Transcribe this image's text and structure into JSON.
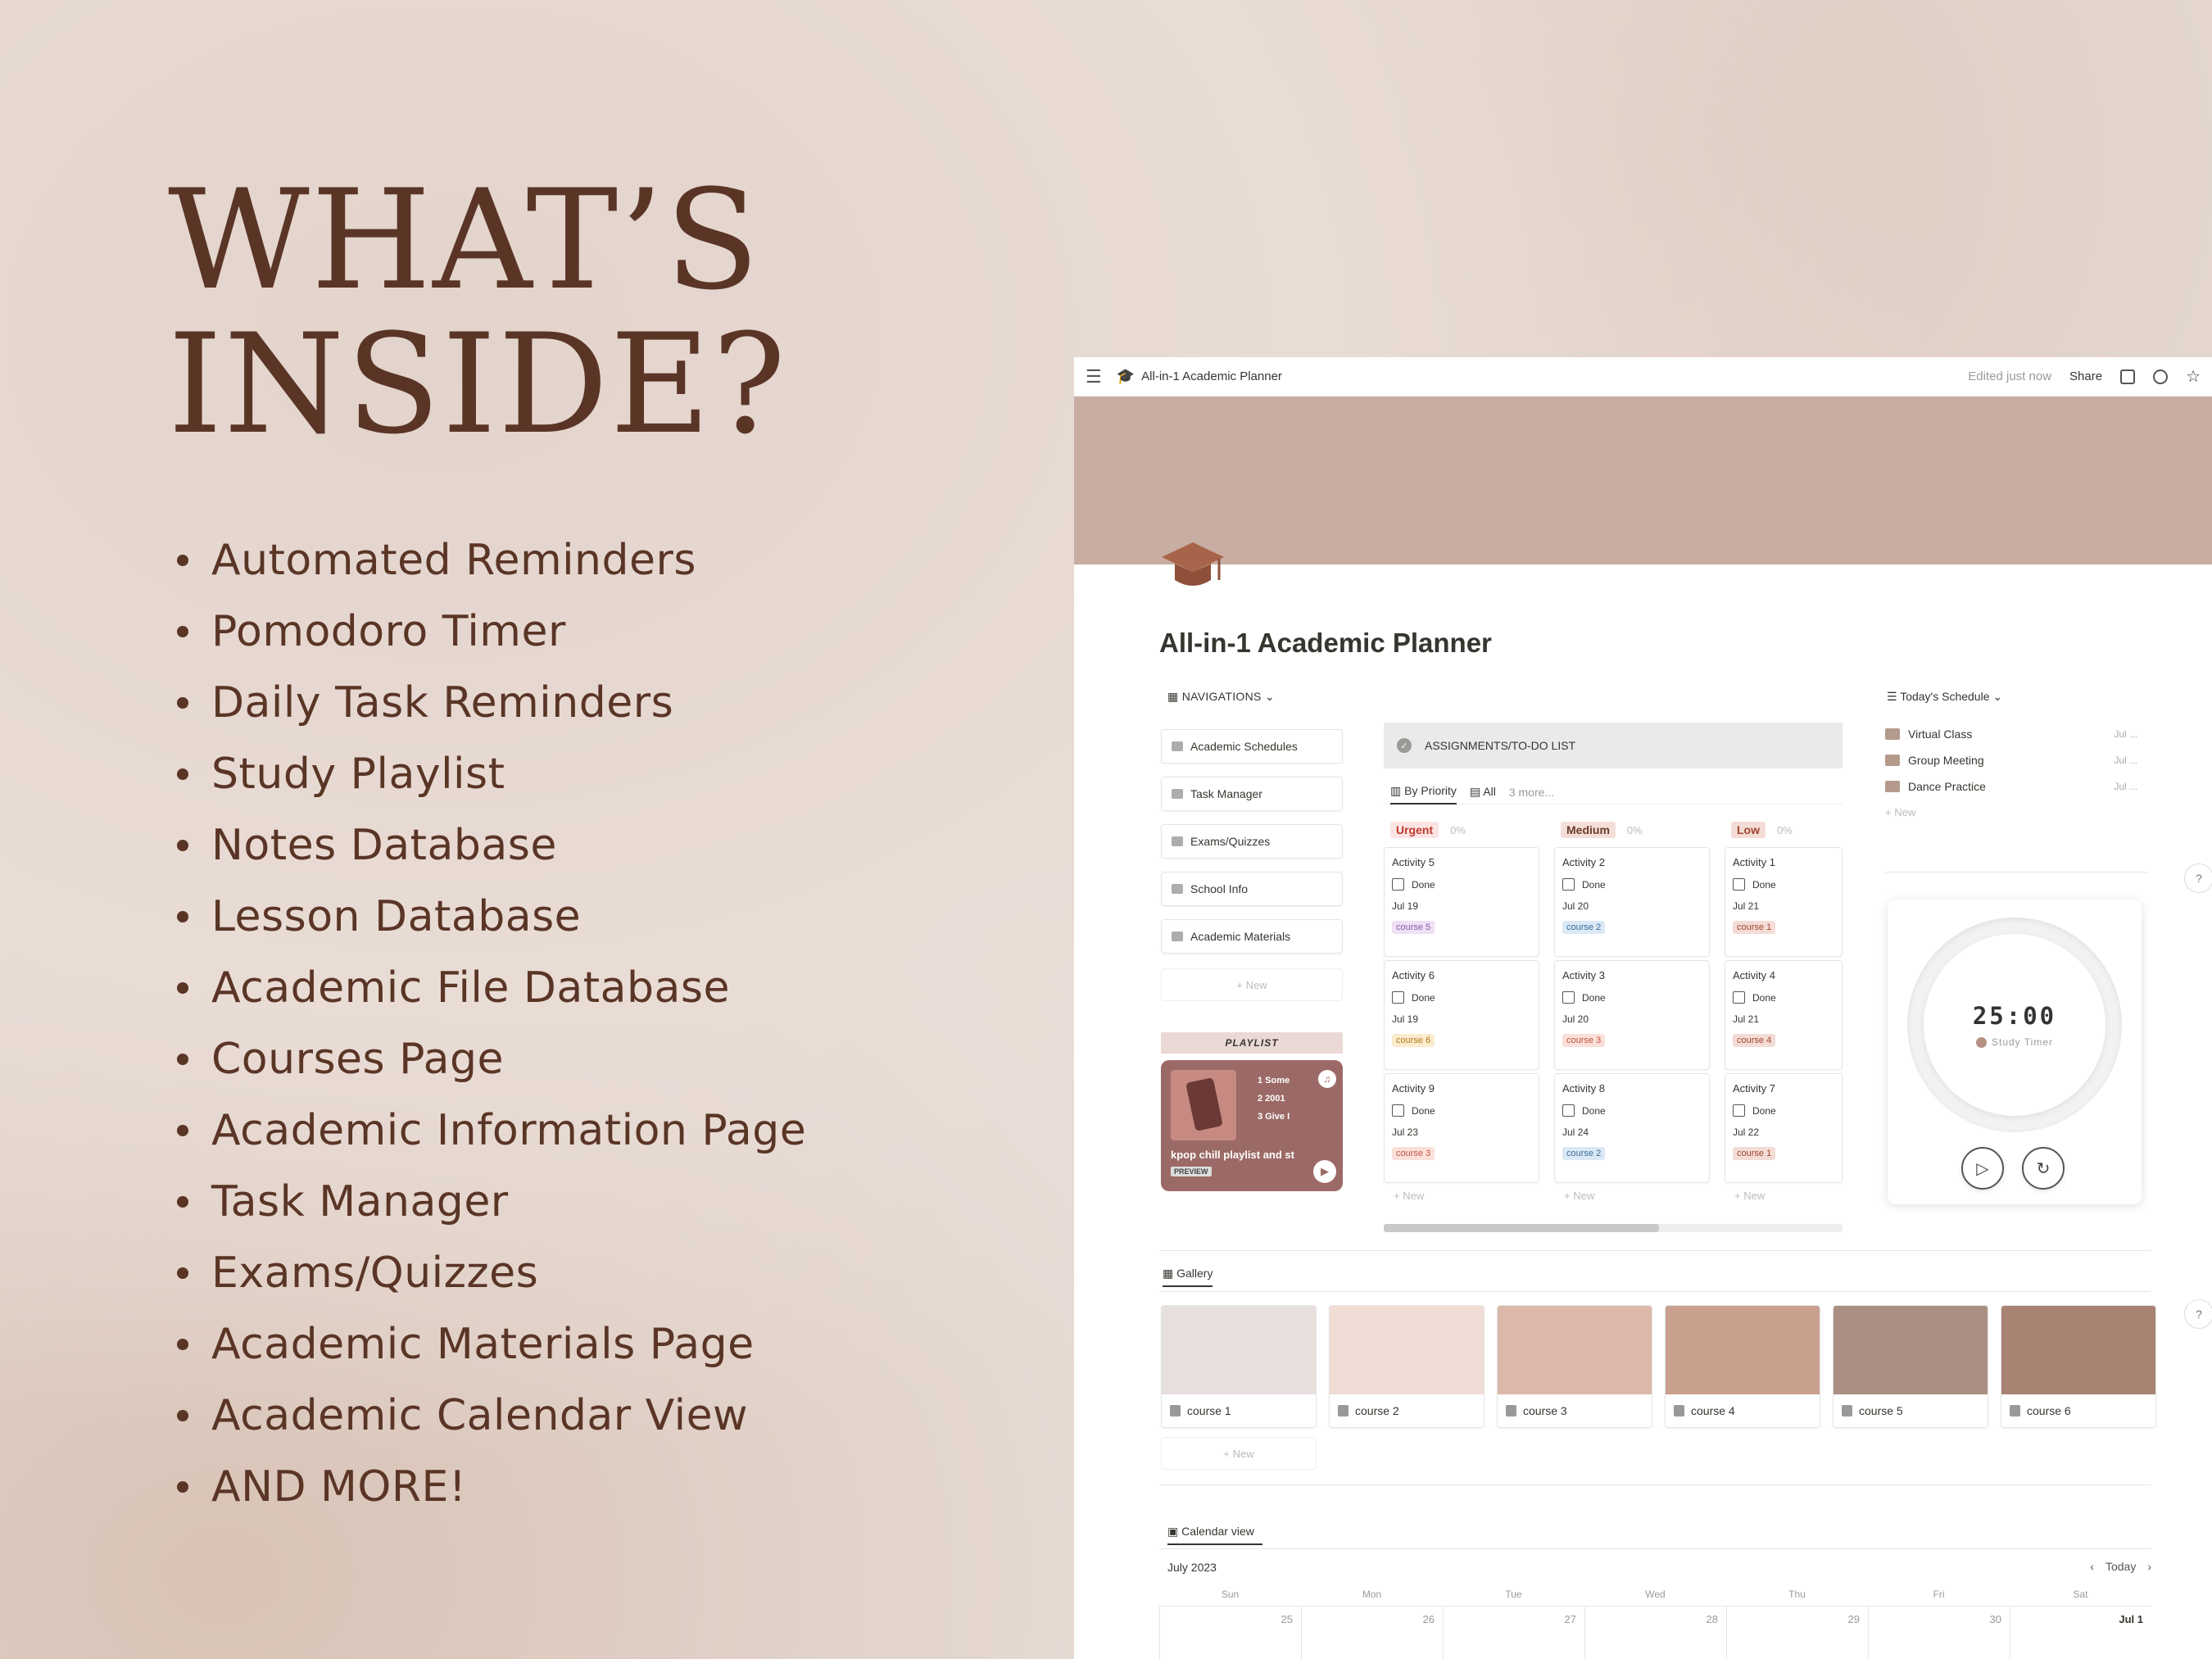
{
  "hero": {
    "line1": "WHAT’S",
    "line2": "INSIDE?"
  },
  "features": [
    "Automated Reminders",
    "Pomodoro Timer",
    "Daily Task Reminders",
    "Study Playlist",
    "Notes Database",
    "Lesson Database",
    "Academic File Database",
    "Courses Page",
    "Academic Information Page",
    "Task Manager",
    "Exams/Quizzes",
    "Academic Materials Page",
    "Academic Calendar View",
    "AND MORE!"
  ],
  "topbar": {
    "breadcrumb": "All-in-1 Academic Planner",
    "edited": "Edited just now",
    "share": "Share"
  },
  "page": {
    "title": "All-in-1 Academic Planner"
  },
  "nav": {
    "heading": "NAVIGATIONS",
    "items": [
      "Academic Schedules",
      "Task Manager",
      "Exams/Quizzes",
      "School Info",
      "Academic Materials"
    ],
    "new": "+ New"
  },
  "playlist": {
    "label": "PLAYLIST",
    "name": "kpop chill playlist and st",
    "preview": "PREVIEW",
    "tracks": [
      "1  Some",
      "2  2001",
      "3  Give I"
    ]
  },
  "assignments": {
    "title": "ASSIGNMENTS/TO-DO LIST",
    "tabs": {
      "by_priority": "By Priority",
      "all": "All",
      "more": "3 more..."
    },
    "columns": [
      {
        "name": "Urgent",
        "pct": "0%",
        "cards": [
          {
            "name": "Activity 5",
            "date": "Jul 19",
            "tag": "course 5"
          },
          {
            "name": "Activity 6",
            "date": "Jul 19",
            "tag": "course 6"
          },
          {
            "name": "Activity 9",
            "date": "Jul 23",
            "tag": "course 3"
          }
        ]
      },
      {
        "name": "Medium",
        "pct": "0%",
        "cards": [
          {
            "name": "Activity 2",
            "date": "Jul 20",
            "tag": "course 2"
          },
          {
            "name": "Activity 3",
            "date": "Jul 20",
            "tag": "course 3"
          },
          {
            "name": "Activity 8",
            "date": "Jul 24",
            "tag": "course 2"
          }
        ]
      },
      {
        "name": "Low",
        "pct": "0%",
        "cards": [
          {
            "name": "Activity 1",
            "date": "Jul 21",
            "tag": "course 1"
          },
          {
            "name": "Activity 4",
            "date": "Jul 21",
            "tag": "course 4"
          },
          {
            "name": "Activity 7",
            "date": "Jul 22",
            "tag": "course 1"
          }
        ]
      }
    ],
    "done_label": "Done",
    "new": "+ New"
  },
  "schedule": {
    "heading": "Today's Schedule",
    "items": [
      {
        "name": "Virtual Class",
        "date": "Jul ..."
      },
      {
        "name": "Group Meeting",
        "date": "Jul ..."
      },
      {
        "name": "Dance Practice",
        "date": "Jul ..."
      }
    ],
    "new": "+ New"
  },
  "timer": {
    "time": "25:00",
    "label": "Study Timer"
  },
  "gallery": {
    "tab": "Gallery",
    "cards": [
      "course 1",
      "course 2",
      "course 3",
      "course 4",
      "course 5",
      "course 6"
    ],
    "colors": [
      "#e6dfdb",
      "#f0ddd5",
      "#ddb8aa",
      "#c9a08d",
      "#ab8f82",
      "#a88272"
    ],
    "new": "+ New"
  },
  "calendar": {
    "tab": "Calendar view",
    "month": "July 2023",
    "today": "Today",
    "days": [
      "Sun",
      "Mon",
      "Tue",
      "Wed",
      "Thu",
      "Fri",
      "Sat"
    ],
    "dates": [
      "25",
      "26",
      "27",
      "28",
      "29",
      "30",
      "Jul 1"
    ]
  }
}
